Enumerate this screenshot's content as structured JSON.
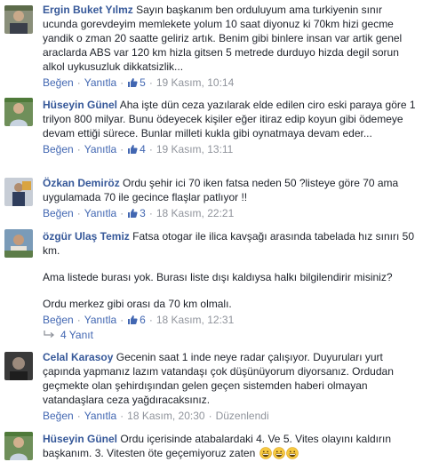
{
  "comments": [
    {
      "author": "Ergin Buket Yılmz",
      "text": "Sayın başkanım ben orduluyum ama turkiyenin sınır ucunda gorevdeyim memlekete yolum 10 saat diyonuz ki 70km hizi gecme yandik o zman 20 saatte geliriz artık. Benim gibi binlere insan var artik genel araclarda ABS var 120 km hizla gitsen 5 metrede durduyo hizda degil sorun alkol uykusuzluk dikkatsizlik...",
      "like_label": "Beğen",
      "reply_label": "Yanıtla",
      "likes": "5",
      "time": "19 Kasım, 10:14"
    },
    {
      "author": "Hüseyin Günel",
      "text": "Aha işte dün ceza yazılarak elde edilen ciro eski paraya göre 1 trilyon 800 milyar. Bunu ödeyecek kişiler eğer itiraz edip koyun gibi ödemeye devam ettiği sürece. Bunlar milleti kukla gibi oynatmaya devam eder...",
      "like_label": "Beğen",
      "reply_label": "Yanıtla",
      "likes": "4",
      "time": "19 Kasım, 13:11"
    },
    {
      "author": "Özkan Demiröz",
      "text": "Ordu şehir ici 70 iken fatsa neden 50 ?listeye göre 70 ama uygulamada 70 ile gecince flaşlar patlıyor !!",
      "like_label": "Beğen",
      "reply_label": "Yanıtla",
      "likes": "3",
      "time": "18 Kasım, 22:21"
    },
    {
      "author": "özgür Ulaş Temiz",
      "text": "Fatsa otogar ile ilica kavşağı arasında tabelada hız sınırı 50 km.",
      "text2": "Ama listede burası yok. Burası liste dışı kaldıysa halkı bilgilendirir misiniz?",
      "text3": "Ordu merkez gibi orası da 70 km olmalı.",
      "like_label": "Beğen",
      "reply_label": "Yanıtla",
      "likes": "6",
      "time": "18 Kasım, 12:31",
      "replies_label": "4 Yanıt"
    },
    {
      "author": "Celal Karasoy",
      "text": "Gecenin saat 1 inde neye radar çalışıyor. Duyuruları yurt çapında yapmanız lazım vatandaşı çok düşünüyorum diyorsanız. Ordudan geçmekte olan şehirdışından gelen geçen sistemden haberi olmayan vatandaşlara ceza yağdıracaksınız.",
      "like_label": "Beğen",
      "reply_label": "Yanıtla",
      "likes": "",
      "time": "18 Kasım, 20:30",
      "edited_label": "Düzenlendi"
    },
    {
      "author": "Hüseyin Günel",
      "text": "Ordu içerisinde atabalardaki 4. Ve 5. Vites olayını kaldırın başkanım. 3. Vitesten öte geçemiyoruz zaten"
    }
  ],
  "colors": {
    "link": "#365899",
    "meta": "#90949c",
    "text": "#1d2129",
    "action": "#4267b2"
  },
  "icons": [
    "like-thumb-icon",
    "reply-arrow-icon",
    "grinning-emoji-icon"
  ]
}
